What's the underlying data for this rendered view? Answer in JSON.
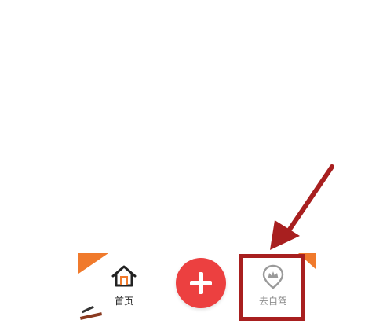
{
  "tabbar": {
    "home_label": "首页",
    "home_icon": "home-icon",
    "add_icon": "plus-icon",
    "drive_label": "去自驾",
    "drive_icon": "map-pin-icon"
  },
  "colors": {
    "accent_red": "#ec4040",
    "annotation_red": "#a81f1f",
    "orange": "#f07a2c",
    "inactive_gray": "#8e8e8e"
  }
}
